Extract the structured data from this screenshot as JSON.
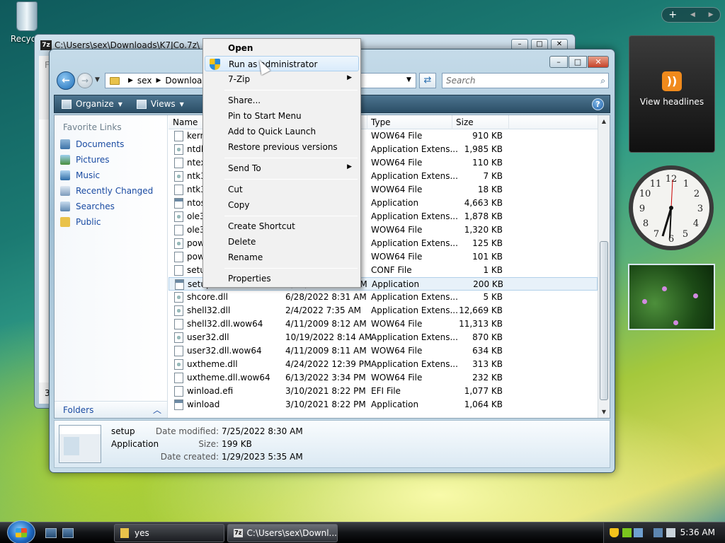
{
  "desktop": {
    "recycle_label": "Recycle"
  },
  "sidebar_gadgets": {
    "feed_label": "View headlines",
    "feed_icon": "rss-icon",
    "ctrl_plus": "+",
    "ctrl_prev": "◀",
    "ctrl_next": "▶"
  },
  "back_window": {
    "title": "C:\\Users\\sex\\Downloads\\K7JCo.7z\\",
    "icon_text": "7z",
    "left_stub": "Fi",
    "status_stub": "36"
  },
  "explorer": {
    "address": {
      "crumbs": [
        "sex",
        "Downloads"
      ]
    },
    "search_placeholder": "Search",
    "toolbar": {
      "organize": "Organize",
      "views": "Views"
    },
    "nav": {
      "favorite_links": "Favorite Links",
      "items": [
        "Documents",
        "Pictures",
        "Music",
        "Recently Changed",
        "Searches",
        "Public"
      ],
      "folders": "Folders"
    },
    "columns": {
      "name": "Name",
      "type": "Type",
      "size": "Size"
    },
    "files": [
      {
        "name": "kern",
        "date": "",
        "type": "WOW64 File",
        "size": "910 KB"
      },
      {
        "name": "ntdll",
        "date": "",
        "type": "Application Extens...",
        "size": "1,985 KB"
      },
      {
        "name": "ntext",
        "date": "",
        "type": "WOW64 File",
        "size": "110 KB"
      },
      {
        "name": "ntk3",
        "date": "",
        "type": "Application Extens...",
        "size": "7 KB"
      },
      {
        "name": "ntk3",
        "date": "",
        "type": "WOW64 File",
        "size": "18 KB"
      },
      {
        "name": "ntos",
        "date": "",
        "type": "Application",
        "size": "4,663 KB"
      },
      {
        "name": "ole32",
        "date": "",
        "type": "Application Extens...",
        "size": "1,878 KB"
      },
      {
        "name": "ole32",
        "date": "",
        "type": "WOW64 File",
        "size": "1,320 KB"
      },
      {
        "name": "pow",
        "date": "",
        "type": "Application Extens...",
        "size": "125 KB"
      },
      {
        "name": "pow",
        "date": "",
        "type": "WOW64 File",
        "size": "101 KB"
      },
      {
        "name": "setup",
        "date": "",
        "type": "CONF File",
        "size": "1 KB"
      },
      {
        "name": "setup",
        "date": "7/25/2022 8:30 AM",
        "type": "Application",
        "size": "200 KB",
        "selected": true
      },
      {
        "name": "shcore.dll",
        "date": "6/28/2022 8:31 AM",
        "type": "Application Extens...",
        "size": "5 KB"
      },
      {
        "name": "shell32.dll",
        "date": "2/4/2022 7:35 AM",
        "type": "Application Extens...",
        "size": "12,669 KB"
      },
      {
        "name": "shell32.dll.wow64",
        "date": "4/11/2009 8:12 AM",
        "type": "WOW64 File",
        "size": "11,313 KB"
      },
      {
        "name": "user32.dll",
        "date": "10/19/2022 8:14 AM",
        "type": "Application Extens...",
        "size": "870 KB"
      },
      {
        "name": "user32.dll.wow64",
        "date": "4/11/2009 8:11 AM",
        "type": "WOW64 File",
        "size": "634 KB"
      },
      {
        "name": "uxtheme.dll",
        "date": "4/24/2022 12:39 PM",
        "type": "Application Extens...",
        "size": "313 KB"
      },
      {
        "name": "uxtheme.dll.wow64",
        "date": "6/13/2022 3:34 PM",
        "type": "WOW64 File",
        "size": "232 KB"
      },
      {
        "name": "winload.efi",
        "date": "3/10/2021 8:22 PM",
        "type": "EFI File",
        "size": "1,077 KB"
      },
      {
        "name": "winload",
        "date": "3/10/2021 8:22 PM",
        "type": "Application",
        "size": "1,064 KB"
      }
    ],
    "details": {
      "name": "setup",
      "type": "Application",
      "modified_label": "Date modified:",
      "modified": "7/25/2022 8:30 AM",
      "size_label": "Size:",
      "size": "199 KB",
      "created_label": "Date created:",
      "created": "1/29/2023 5:35 AM"
    }
  },
  "context_menu": {
    "open": "Open",
    "run_as_admin": "Run as administrator",
    "seven_zip": "7-Zip",
    "share": "Share...",
    "pin_start": "Pin to Start Menu",
    "quick_launch": "Add to Quick Launch",
    "restore": "Restore previous versions",
    "send_to": "Send To",
    "cut": "Cut",
    "copy": "Copy",
    "create_shortcut": "Create Shortcut",
    "delete": "Delete",
    "rename": "Rename",
    "properties": "Properties"
  },
  "taskbar": {
    "buttons": [
      "yes",
      "C:\\Users\\sex\\Downl..."
    ],
    "seven_zip_icon": "7z",
    "clock": "5:36 AM"
  },
  "colors": {
    "link_blue": "#1a4ba2",
    "toolbar": "#2b4e66",
    "selection": "#e7f1f9"
  }
}
